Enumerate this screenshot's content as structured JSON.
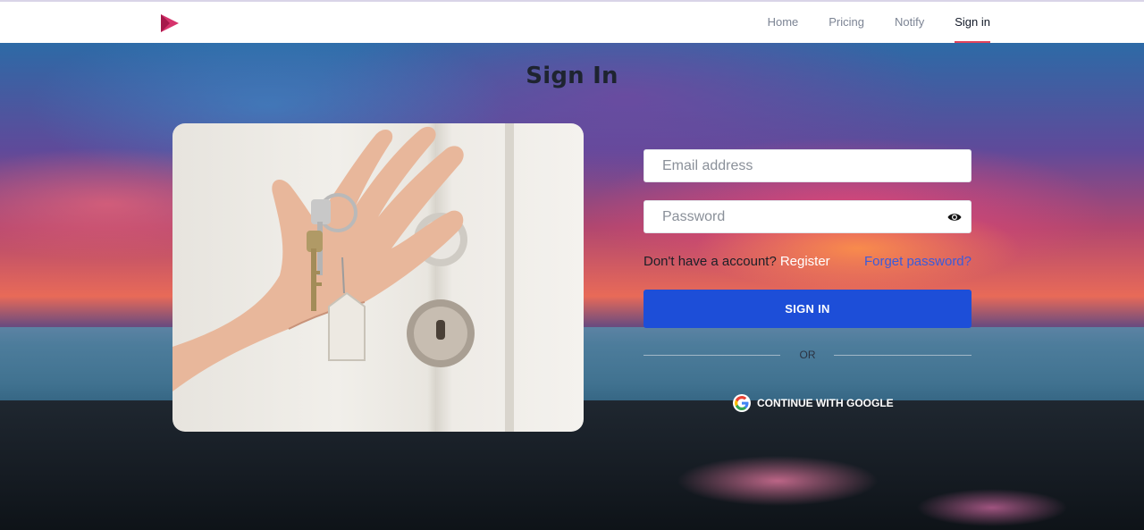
{
  "nav": {
    "links": [
      {
        "label": "Home"
      },
      {
        "label": "Pricing"
      },
      {
        "label": "Notify"
      },
      {
        "label": "Sign in"
      }
    ]
  },
  "page": {
    "title": "Sign In"
  },
  "form": {
    "email_placeholder": "Email address",
    "password_placeholder": "Password",
    "no_account_text": "Don't have a account?",
    "register_label": "Register",
    "forgot_label": "Forget password?",
    "signin_label": "SIGN IN",
    "or_text": "OR",
    "google_label": "CONTINUE WITH GOOGLE"
  },
  "colors": {
    "accent": "#1d4ed8",
    "nav_underline": "#e2445c",
    "logo": "#d6336c"
  },
  "icons": {
    "logo": "play-logo-icon",
    "password_toggle": "eye-icon",
    "google": "google-icon"
  }
}
